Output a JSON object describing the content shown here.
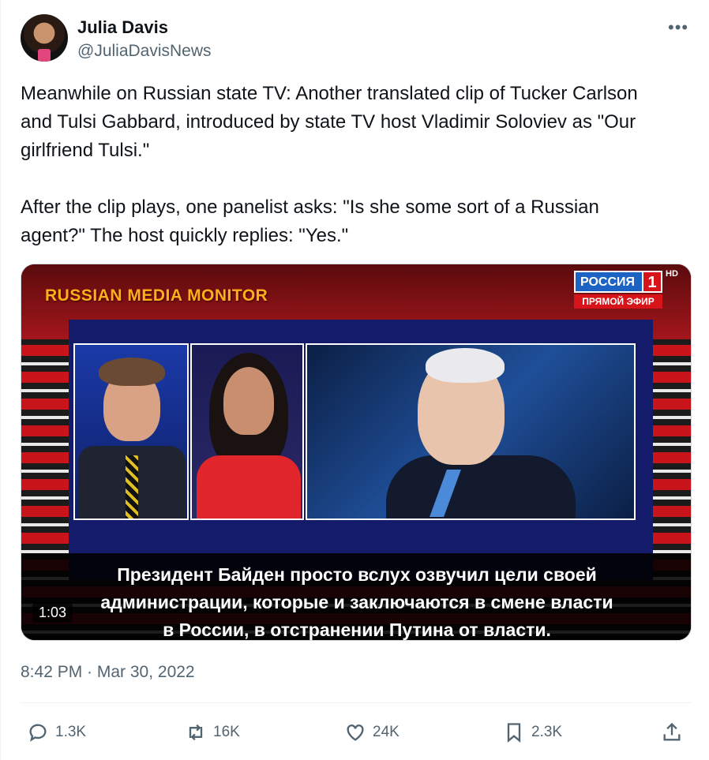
{
  "author": {
    "name": "Julia Davis",
    "handle": "@JuliaDavisNews"
  },
  "menu": {
    "more_label": "•••"
  },
  "tweet": {
    "paragraph1": "Meanwhile on Russian state TV: Another translated clip of Tucker Carlson and Tulsi Gabbard, introduced by state TV host Vladimir Soloviev as \"Our girlfriend Tulsi.\"",
    "paragraph2": "After the clip plays, one panelist asks: \"Is she some sort of a Russian agent?\" The host quickly replies: \"Yes.\""
  },
  "media": {
    "watermark": "RUSSIAN MEDIA MONITOR",
    "channel_logo": "РОССИЯ",
    "channel_number": "1",
    "hd_label": "HD",
    "live_label": "ПРЯМОЙ ЭФИР",
    "subtitle_line1": "Президент Байден просто вслух озвучил цели своей",
    "subtitle_line2": "администрации, которые и заключаются в смене власти",
    "subtitle_line3": "в России, в отстранении Путина от власти.",
    "duration": "1:03"
  },
  "timestamp": "8:42 PM · Mar 30, 2022",
  "actions": {
    "replies": "1.3K",
    "reposts": "16K",
    "likes": "24K",
    "bookmarks": "2.3K"
  }
}
